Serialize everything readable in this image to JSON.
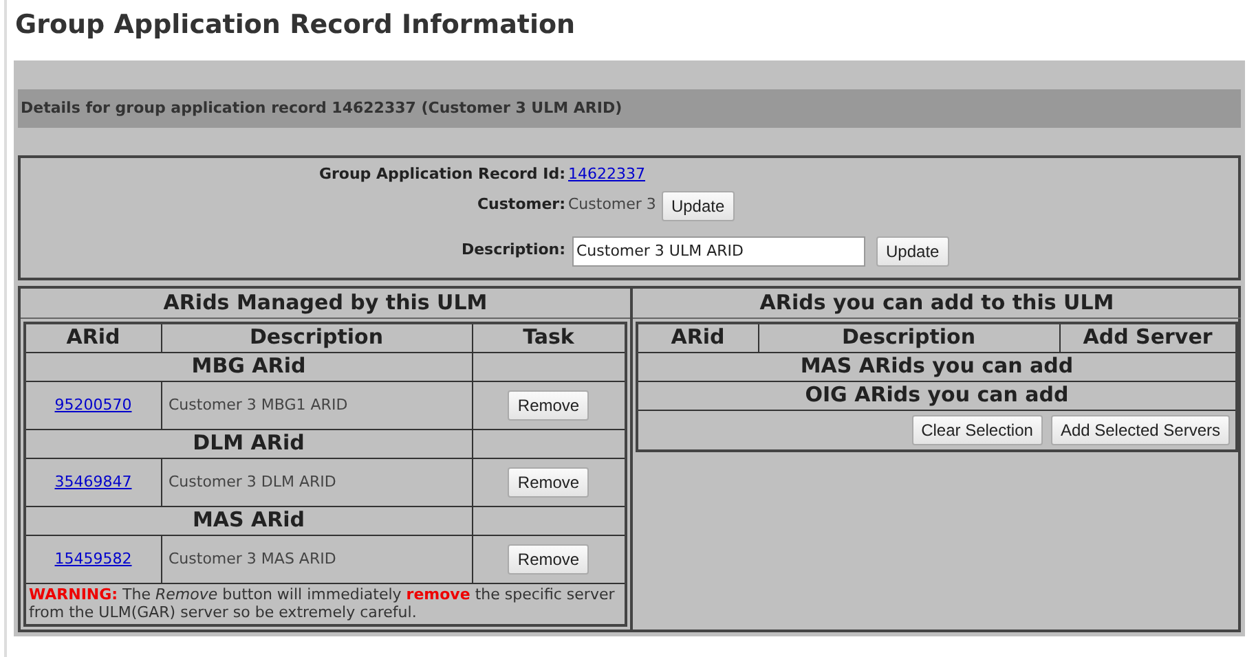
{
  "title": "Group Application Record Information",
  "details_bar": "Details for group application record 14622337 (Customer 3 ULM ARID)",
  "record": {
    "id_label": "Group Application Record Id:",
    "id_value": "14622337",
    "customer_label": "Customer:",
    "customer_value": "Customer 3",
    "customer_button": "Update",
    "description_label": "Description:",
    "description_value": "Customer 3 ULM ARID",
    "description_button": "Update"
  },
  "managed": {
    "title": "ARids Managed by this ULM",
    "columns": [
      "ARid",
      "Description",
      "Task"
    ],
    "groups": [
      {
        "heading": "MBG ARid",
        "rows": [
          {
            "arid": "95200570",
            "description": "Customer 3 MBG1 ARID",
            "button": "Remove"
          }
        ]
      },
      {
        "heading": "DLM ARid",
        "rows": [
          {
            "arid": "35469847",
            "description": "Customer 3 DLM ARID",
            "button": "Remove"
          }
        ]
      },
      {
        "heading": "MAS ARid",
        "rows": [
          {
            "arid": "15459582",
            "description": "Customer 3 MAS ARID",
            "button": "Remove"
          }
        ]
      }
    ],
    "warning": "**WARNING:** The *Remove* button will immediately **remove** the specific server from the ULM(GAR) server so be extremely careful."
  },
  "available": {
    "title": "ARids you can add to this ULM",
    "columns": [
      "ARid",
      "Description",
      "Add Server"
    ],
    "groups": [
      "MAS ARids you can add",
      "OIG ARids you can add"
    ],
    "buttons": [
      "Clear Selection",
      "Add Selected Servers"
    ]
  }
}
